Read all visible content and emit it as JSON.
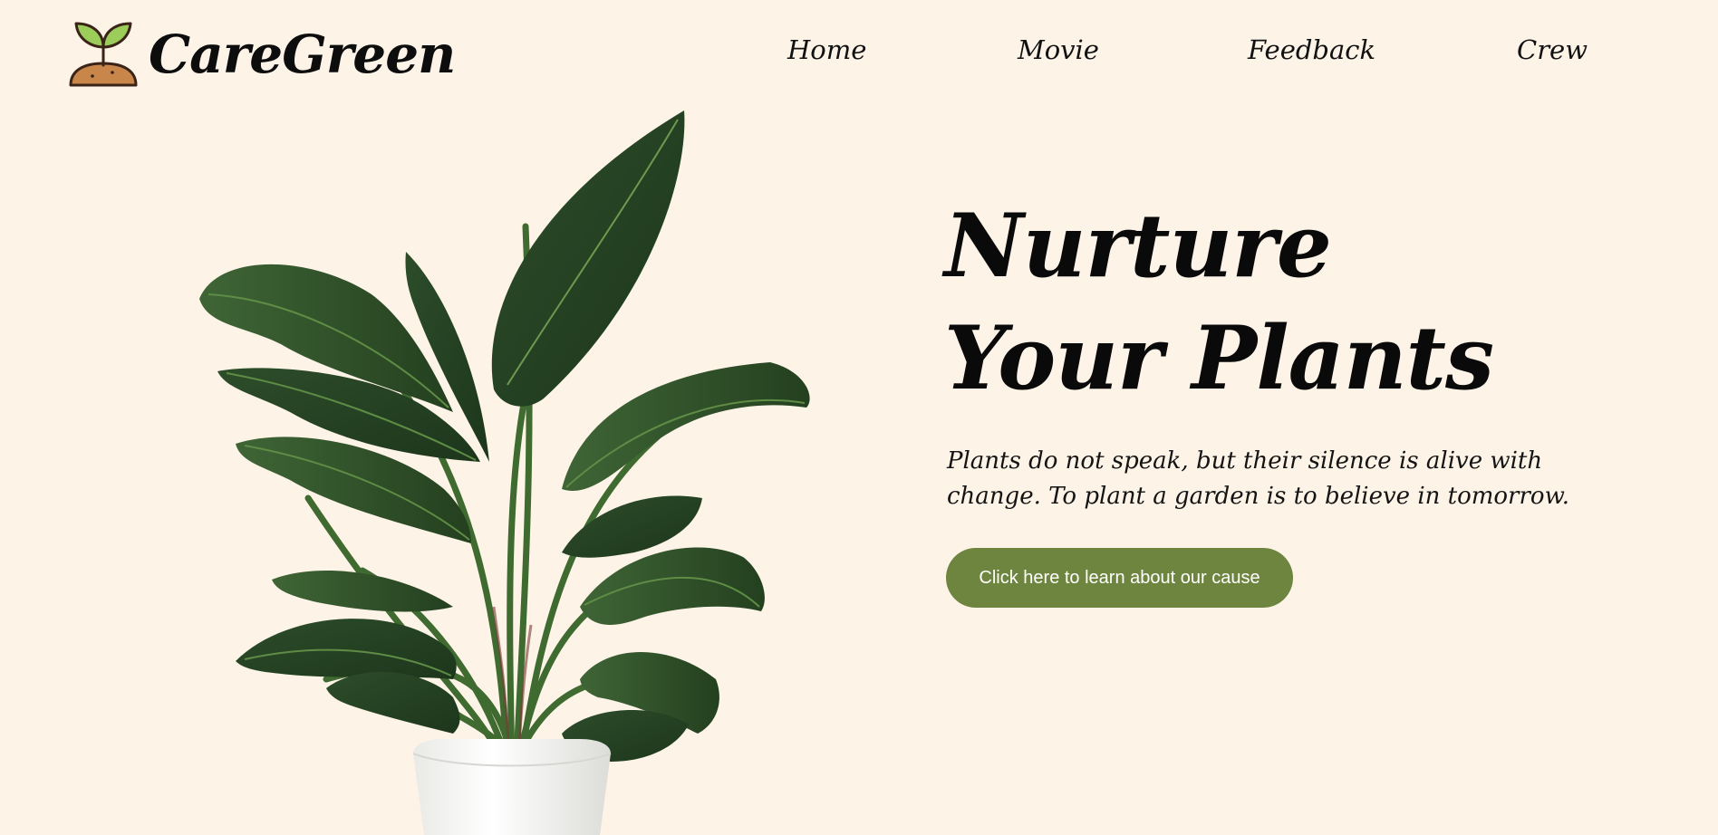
{
  "brand": {
    "name": "CareGreen",
    "logo_icon": "sprout-in-soil-icon"
  },
  "nav": {
    "items": [
      {
        "label": "Home"
      },
      {
        "label": "Movie"
      },
      {
        "label": "Feedback"
      },
      {
        "label": "Crew"
      }
    ]
  },
  "hero": {
    "title_line1": "Nurture",
    "title_line2": "Your Plants",
    "description": "Plants do not speak, but their silence is alive with change. To plant a garden is to believe in tomorrow.",
    "cta_label": "Click here to learn about our cause",
    "image_icon": "potted-plant-image"
  },
  "colors": {
    "background": "#fdf3e7",
    "accent": "#6e8540",
    "leaf_dark": "#243f22",
    "leaf_mid": "#3b5e33",
    "soil": "#c9864a",
    "sprout": "#9ccc5a",
    "pot": "#f6f6f4"
  }
}
